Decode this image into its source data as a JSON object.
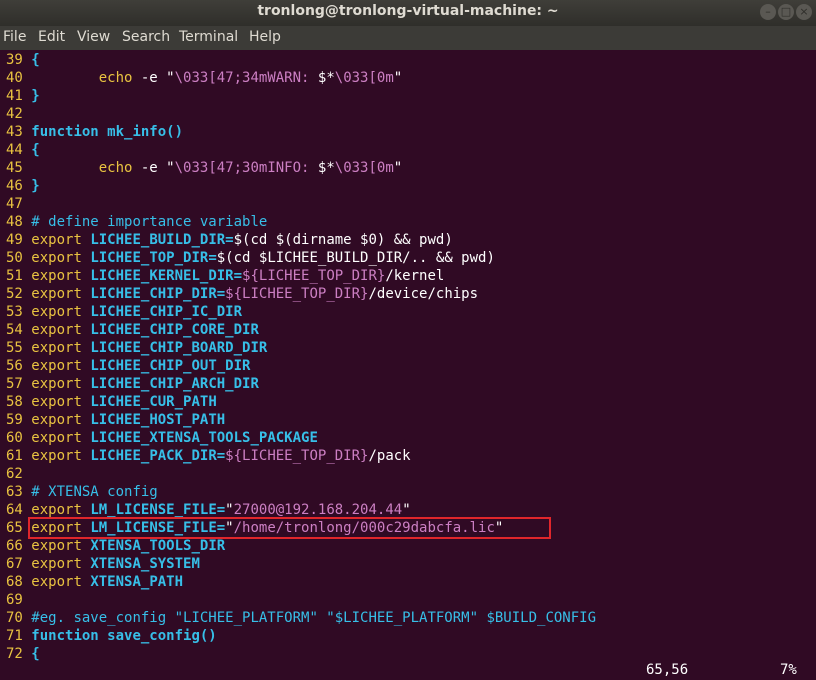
{
  "window": {
    "title": "tronlong@tronlong-virtual-machine: ~"
  },
  "menu": [
    "File",
    "Edit",
    "View",
    "Search",
    "Terminal",
    "Help"
  ],
  "lines": [
    {
      "n": "39",
      "segs": [
        {
          "c": "kw",
          "t": "{"
        }
      ]
    },
    {
      "n": "40",
      "segs": [
        {
          "c": "txt",
          "t": "        "
        },
        {
          "c": "cmd",
          "t": "echo"
        },
        {
          "c": "txt",
          "t": " -e "
        },
        {
          "c": "txt",
          "t": "\""
        },
        {
          "c": "str",
          "t": "\\033[47;34mWARN: "
        },
        {
          "c": "txt",
          "t": "$*"
        },
        {
          "c": "str",
          "t": "\\033[0m"
        },
        {
          "c": "txt",
          "t": "\""
        }
      ]
    },
    {
      "n": "41",
      "segs": [
        {
          "c": "kw",
          "t": "}"
        }
      ]
    },
    {
      "n": "42",
      "segs": []
    },
    {
      "n": "43",
      "segs": [
        {
          "c": "kw",
          "t": "function mk_info()"
        }
      ]
    },
    {
      "n": "44",
      "segs": [
        {
          "c": "kw",
          "t": "{"
        }
      ]
    },
    {
      "n": "45",
      "segs": [
        {
          "c": "txt",
          "t": "        "
        },
        {
          "c": "cmd",
          "t": "echo"
        },
        {
          "c": "txt",
          "t": " -e "
        },
        {
          "c": "txt",
          "t": "\""
        },
        {
          "c": "str",
          "t": "\\033[47;30mINFO: "
        },
        {
          "c": "txt",
          "t": "$*"
        },
        {
          "c": "str",
          "t": "\\033[0m"
        },
        {
          "c": "txt",
          "t": "\""
        }
      ]
    },
    {
      "n": "46",
      "segs": [
        {
          "c": "kw",
          "t": "}"
        }
      ]
    },
    {
      "n": "47",
      "segs": []
    },
    {
      "n": "48",
      "segs": [
        {
          "c": "cm",
          "t": "# define importance variable"
        }
      ]
    },
    {
      "n": "49",
      "segs": [
        {
          "c": "cmd",
          "t": "export "
        },
        {
          "c": "id",
          "t": "LICHEE_BUILD_DIR="
        },
        {
          "c": "txt",
          "t": "$(cd $(dirname $0) && pwd)"
        }
      ]
    },
    {
      "n": "50",
      "segs": [
        {
          "c": "cmd",
          "t": "export "
        },
        {
          "c": "id",
          "t": "LICHEE_TOP_DIR="
        },
        {
          "c": "txt",
          "t": "$(cd $LICHEE_BUILD_DIR/.. && pwd)"
        }
      ]
    },
    {
      "n": "51",
      "segs": [
        {
          "c": "cmd",
          "t": "export "
        },
        {
          "c": "id",
          "t": "LICHEE_KERNEL_DIR="
        },
        {
          "c": "str",
          "t": "${LICHEE_TOP_DIR}"
        },
        {
          "c": "txt",
          "t": "/kernel"
        }
      ]
    },
    {
      "n": "52",
      "segs": [
        {
          "c": "cmd",
          "t": "export "
        },
        {
          "c": "id",
          "t": "LICHEE_CHIP_DIR="
        },
        {
          "c": "str",
          "t": "${LICHEE_TOP_DIR}"
        },
        {
          "c": "txt",
          "t": "/device/chips"
        }
      ]
    },
    {
      "n": "53",
      "segs": [
        {
          "c": "cmd",
          "t": "export "
        },
        {
          "c": "id",
          "t": "LICHEE_CHIP_IC_DIR"
        }
      ]
    },
    {
      "n": "54",
      "segs": [
        {
          "c": "cmd",
          "t": "export "
        },
        {
          "c": "id",
          "t": "LICHEE_CHIP_CORE_DIR"
        }
      ]
    },
    {
      "n": "55",
      "segs": [
        {
          "c": "cmd",
          "t": "export "
        },
        {
          "c": "id",
          "t": "LICHEE_CHIP_BOARD_DIR"
        }
      ]
    },
    {
      "n": "56",
      "segs": [
        {
          "c": "cmd",
          "t": "export "
        },
        {
          "c": "id",
          "t": "LICHEE_CHIP_OUT_DIR"
        }
      ]
    },
    {
      "n": "57",
      "segs": [
        {
          "c": "cmd",
          "t": "export "
        },
        {
          "c": "id",
          "t": "LICHEE_CHIP_ARCH_DIR"
        }
      ]
    },
    {
      "n": "58",
      "segs": [
        {
          "c": "cmd",
          "t": "export "
        },
        {
          "c": "id",
          "t": "LICHEE_CUR_PATH"
        }
      ]
    },
    {
      "n": "59",
      "segs": [
        {
          "c": "cmd",
          "t": "export "
        },
        {
          "c": "id",
          "t": "LICHEE_HOST_PATH"
        }
      ]
    },
    {
      "n": "60",
      "segs": [
        {
          "c": "cmd",
          "t": "export "
        },
        {
          "c": "id",
          "t": "LICHEE_XTENSA_TOOLS_PACKAGE"
        }
      ]
    },
    {
      "n": "61",
      "segs": [
        {
          "c": "cmd",
          "t": "export "
        },
        {
          "c": "id",
          "t": "LICHEE_PACK_DIR="
        },
        {
          "c": "str",
          "t": "${LICHEE_TOP_DIR}"
        },
        {
          "c": "txt",
          "t": "/pack"
        }
      ]
    },
    {
      "n": "62",
      "segs": []
    },
    {
      "n": "63",
      "segs": [
        {
          "c": "cm",
          "t": "# XTENSA config"
        }
      ]
    },
    {
      "n": "64",
      "segs": [
        {
          "c": "cmd",
          "t": "export "
        },
        {
          "c": "id",
          "t": "LM_LICENSE_FILE="
        },
        {
          "c": "txt",
          "t": "\""
        },
        {
          "c": "str",
          "t": "27000@192.168.204.44"
        },
        {
          "c": "txt",
          "t": "\""
        }
      ]
    },
    {
      "n": "65",
      "segs": [
        {
          "c": "cmd",
          "t": "export "
        },
        {
          "c": "id",
          "t": "LM_LICENSE_FILE="
        },
        {
          "c": "txt",
          "t": "\""
        },
        {
          "c": "str",
          "t": "/home/tronlong/000c29dabcfa.lic"
        },
        {
          "c": "txt",
          "t": "\""
        }
      ]
    },
    {
      "n": "66",
      "segs": [
        {
          "c": "cmd",
          "t": "export "
        },
        {
          "c": "id",
          "t": "XTENSA_TOOLS_DIR"
        }
      ]
    },
    {
      "n": "67",
      "segs": [
        {
          "c": "cmd",
          "t": "export "
        },
        {
          "c": "id",
          "t": "XTENSA_SYSTEM"
        }
      ]
    },
    {
      "n": "68",
      "segs": [
        {
          "c": "cmd",
          "t": "export "
        },
        {
          "c": "id",
          "t": "XTENSA_PATH"
        }
      ]
    },
    {
      "n": "69",
      "segs": []
    },
    {
      "n": "70",
      "segs": [
        {
          "c": "cm",
          "t": "#eg. save_config \"LICHEE_PLATFORM\" \"$LICHEE_PLATFORM\" $BUILD_CONFIG"
        }
      ]
    },
    {
      "n": "71",
      "segs": [
        {
          "c": "kw",
          "t": "function save_config()"
        }
      ]
    },
    {
      "n": "72",
      "segs": [
        {
          "c": "kw",
          "t": "{"
        }
      ]
    }
  ],
  "status": {
    "position": "65,56",
    "percent": "7%"
  }
}
